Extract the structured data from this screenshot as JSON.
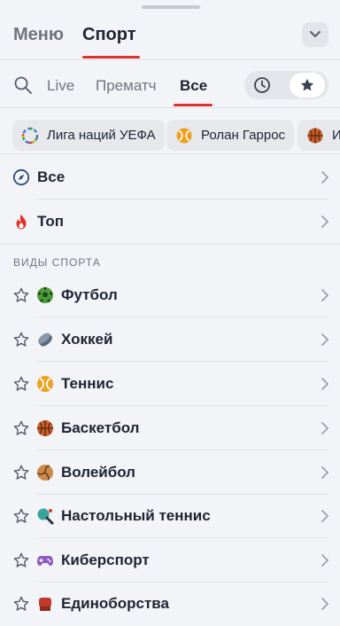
{
  "header": {
    "tabs": [
      {
        "label": "Меню",
        "active": false
      },
      {
        "label": "Спорт",
        "active": true
      }
    ]
  },
  "filters": {
    "tabs": [
      {
        "label": "Live",
        "active": false
      },
      {
        "label": "Прематч",
        "active": false
      },
      {
        "label": "Все",
        "active": true
      }
    ],
    "toggles": [
      "clock-icon",
      "star-icon"
    ],
    "active_toggle": "star-icon"
  },
  "chips": [
    {
      "label": "Лига наций УЕФА",
      "icon": "uefa-icon"
    },
    {
      "label": "Ролан Гаррос",
      "icon": "tennis-ball-icon"
    },
    {
      "label": "Ис",
      "icon": "basketball-icon"
    }
  ],
  "quick_links": [
    {
      "label": "Все",
      "icon": "compass-icon"
    },
    {
      "label": "Топ",
      "icon": "fire-icon"
    }
  ],
  "section": {
    "title": "ВИДЫ СПОРТА"
  },
  "sports": [
    {
      "label": "Футбол",
      "icon": "football-icon"
    },
    {
      "label": "Хоккей",
      "icon": "hockey-puck-icon"
    },
    {
      "label": "Теннис",
      "icon": "tennis-ball-icon"
    },
    {
      "label": "Баскетбол",
      "icon": "basketball-icon"
    },
    {
      "label": "Волейбол",
      "icon": "volleyball-icon"
    },
    {
      "label": "Настольный теннис",
      "icon": "table-tennis-icon"
    },
    {
      "label": "Киберспорт",
      "icon": "gamepad-icon"
    },
    {
      "label": "Единоборства",
      "icon": "boxing-glove-icon"
    }
  ],
  "colors": {
    "accent": "#e0322c",
    "text": "#1d2433",
    "muted": "#6e7480",
    "background": "#f3f4f7"
  }
}
